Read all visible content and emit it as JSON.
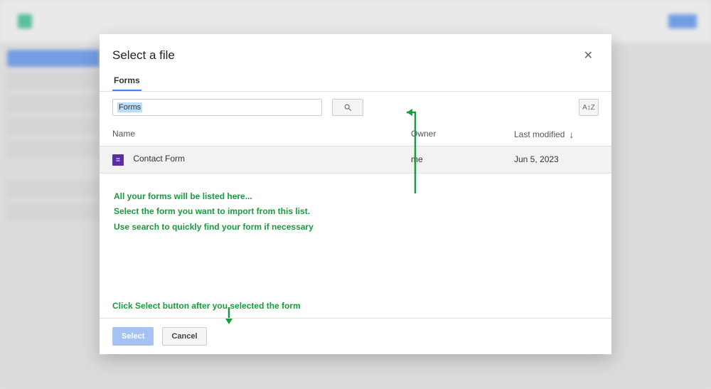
{
  "dialog": {
    "title": "Select a file",
    "close_symbol": "✕",
    "tabs": [
      {
        "label": "Forms"
      }
    ],
    "search": {
      "value": "Forms",
      "sort_icon": "A↕Z"
    },
    "table": {
      "headers": {
        "name": "Name",
        "owner": "Owner",
        "modified": "Last modified"
      },
      "sort_arrow": "↓",
      "rows": [
        {
          "icon_glyph": "≣",
          "name": "Contact Form",
          "owner": "me",
          "modified": "Jun 5, 2023"
        }
      ]
    },
    "footer": {
      "select_label": "Select",
      "cancel_label": "Cancel"
    }
  },
  "annotations": {
    "line1": "All your forms will be listed here...",
    "line2": "Select the form you want to import from this list.",
    "line3": "Use search to quickly find your form if necessary",
    "bottom": "Click Select button after you selected the form"
  },
  "colors": {
    "accent": "#4285f4",
    "annotation": "#179b3e",
    "forms_icon": "#5e2ca5"
  }
}
